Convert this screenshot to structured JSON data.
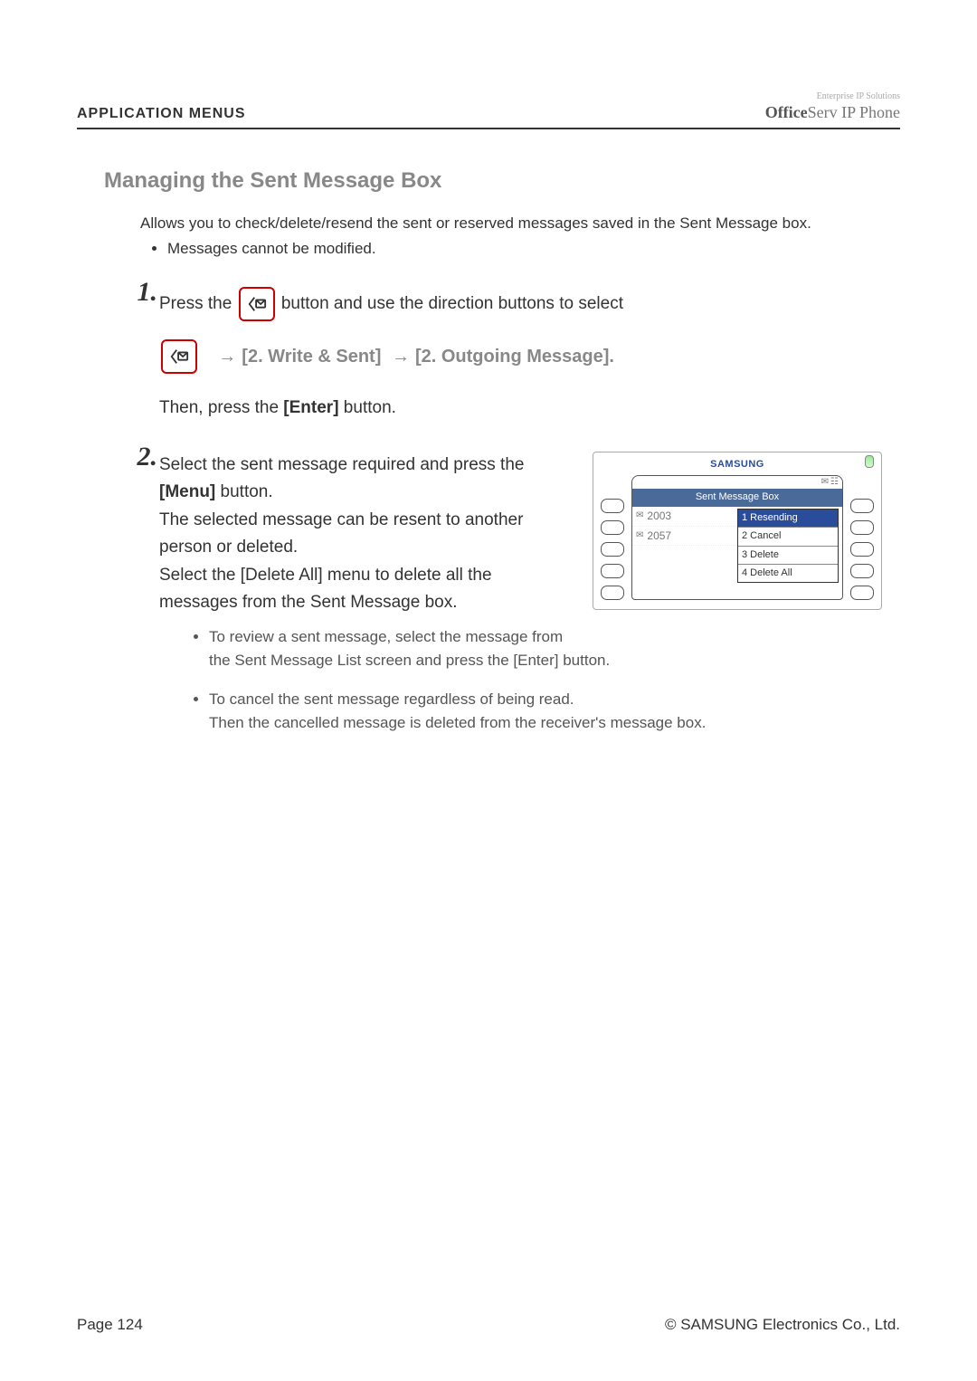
{
  "header": {
    "section": "APPLICATION MENUS",
    "brand_tag": "Enterprise IP Solutions",
    "brand_bold": "Office",
    "brand_rest": "Serv IP Phone"
  },
  "title": "Managing the Sent Message Box",
  "intro": "Allows you to check/delete/resend the sent or reserved messages saved in the Sent Message box.",
  "intro_bullet": "Messages cannot be modified.",
  "steps": {
    "s1": {
      "num": "1.",
      "pre": "Press the ",
      "post": " button and use the direction buttons to select",
      "path_a": "[2. Write & Sent]",
      "path_b": "[2. Outgoing Message].",
      "then_a": "Then, press the ",
      "then_bold": "[Enter]",
      "then_b": " button."
    },
    "s2": {
      "num": "2.",
      "l1a": "Select the sent message required and press the ",
      "l1bold": "[Menu]",
      "l1b": " button.",
      "l2": "The selected message can be resent to another person or deleted.",
      "l3": "Select the [Delete All] menu to delete all the messages from the Sent Message box.",
      "sub1a": "To review a sent message, select the message from",
      "sub1b": "the Sent Message List screen and press the [Enter] button.",
      "sub2a": "To cancel the sent message regardless of being read.",
      "sub2b": "Then the cancelled message is deleted from the receiver's message box."
    }
  },
  "phone": {
    "brand": "SAMSUNG",
    "screen_title": "Sent Message Box",
    "items": [
      "2003",
      "2057"
    ],
    "popup": [
      "1 Resending",
      "2 Cancel",
      "3 Delete",
      "4 Delete All"
    ]
  },
  "footer": {
    "left": "Page 124",
    "right": "© SAMSUNG Electronics Co., Ltd."
  }
}
